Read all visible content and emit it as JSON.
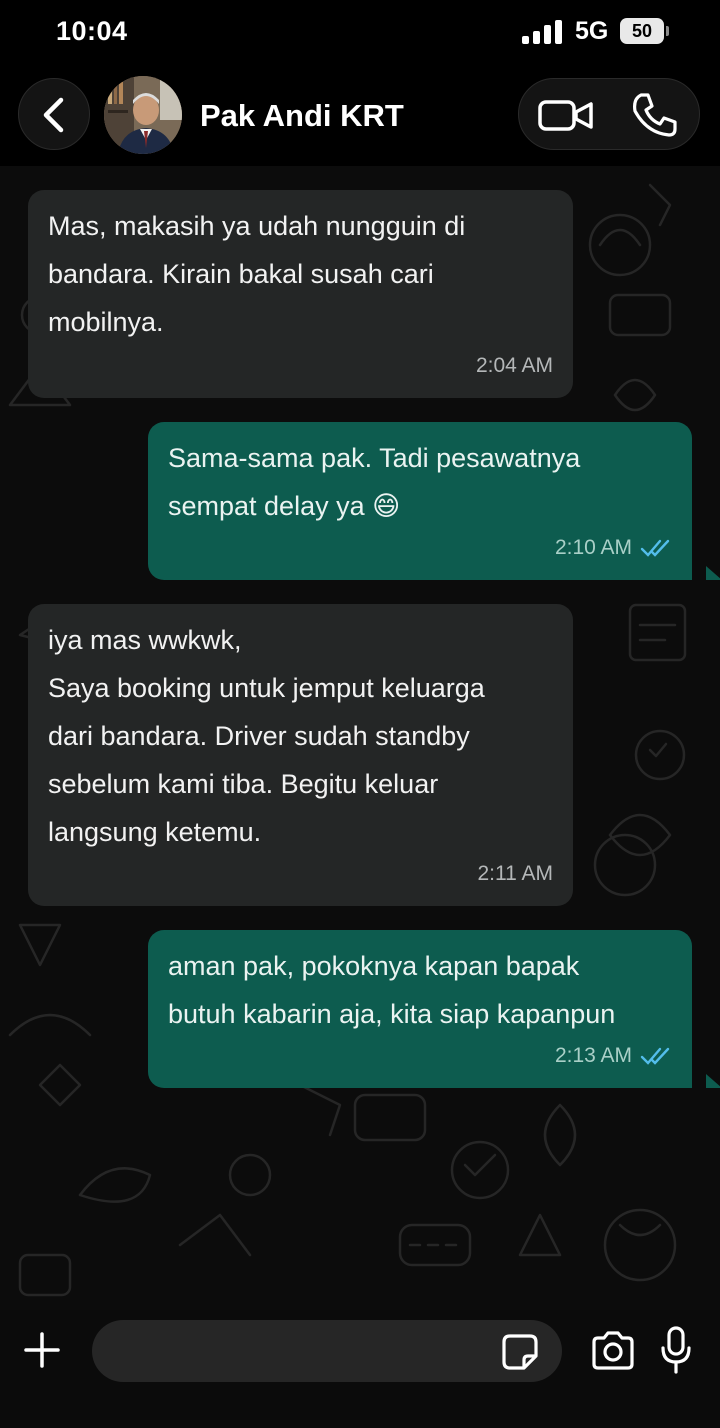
{
  "status_bar": {
    "time": "10:04",
    "network": "5G",
    "battery": "50"
  },
  "header": {
    "contact_name": "Pak Andi KRT"
  },
  "messages": [
    {
      "direction": "incoming",
      "lines": [
        "Mas, makasih ya udah nungguin di",
        "bandara. Kirain bakal susah cari",
        "mobilnya."
      ],
      "time": "2:04 AM"
    },
    {
      "direction": "outgoing",
      "lines": [
        "Sama-sama pak. Tadi pesawatnya",
        "sempat delay ya 😄"
      ],
      "time": "2:10 AM",
      "status": "read"
    },
    {
      "direction": "incoming",
      "lines": [
        "iya mas wwkwk,",
        "Saya booking untuk jemput keluarga",
        "dari bandara. Driver sudah standby",
        "sebelum kami tiba. Begitu keluar",
        "langsung ketemu."
      ],
      "time": "2:11 AM"
    },
    {
      "direction": "outgoing",
      "lines": [
        "aman pak, pokoknya kapan bapak",
        "butuh kabarin aja, kita siap kapanpun"
      ],
      "time": "2:13 AM",
      "status": "read"
    }
  ],
  "composer": {
    "value": "",
    "placeholder": ""
  },
  "colors": {
    "incoming_bubble": "#242626",
    "outgoing_bubble": "#0d5c4f",
    "read_ticks": "#53bdeb",
    "background": "#0b0b0b"
  },
  "icons": [
    "back-arrow-icon",
    "video-call-icon",
    "phone-icon",
    "plus-icon",
    "sticker-icon",
    "camera-icon",
    "microphone-icon",
    "double-check-icon"
  ]
}
